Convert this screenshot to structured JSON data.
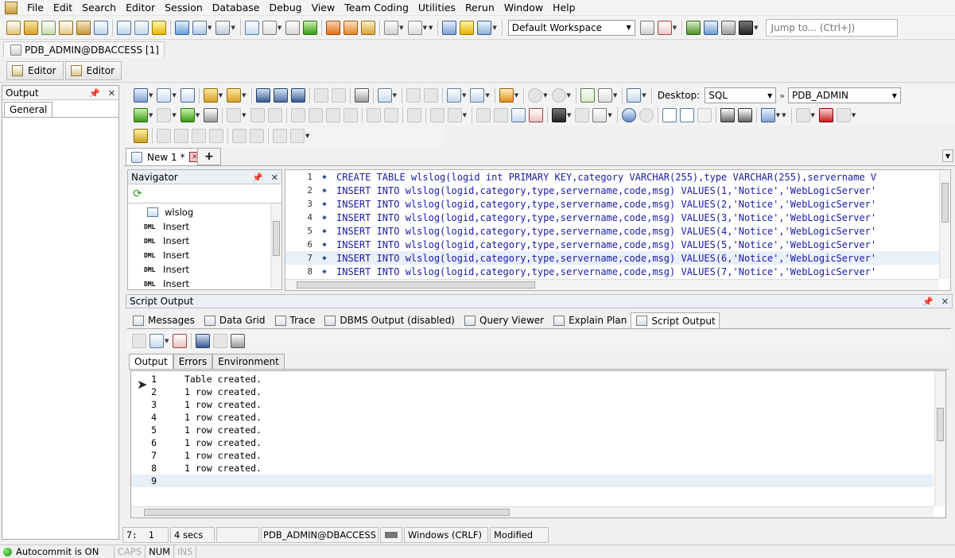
{
  "menu": [
    "File",
    "Edit",
    "Search",
    "Editor",
    "Session",
    "Database",
    "Debug",
    "View",
    "Team Coding",
    "Utilities",
    "Rerun",
    "Window",
    "Help"
  ],
  "toolbar": {
    "workspace": "Default Workspace",
    "jump_placeholder": "Jump to... (Ctrl+J)"
  },
  "connection_tab": "PDB_ADMIN@DBACCESS [1]",
  "editor_buttons": [
    "Editor",
    "Editor"
  ],
  "output_panel": {
    "title": "Output",
    "tab": "General"
  },
  "edit_toolbar": {
    "desktop_label": "Desktop:",
    "desktop_value": "SQL",
    "schema": "PDB_ADMIN"
  },
  "doc_tab": {
    "label": "New 1 *",
    "add": "+"
  },
  "navigator": {
    "title": "Navigator",
    "items": [
      {
        "badge": "",
        "label": "wlslog"
      },
      {
        "badge": "DML",
        "label": "Insert"
      },
      {
        "badge": "DML",
        "label": "Insert"
      },
      {
        "badge": "DML",
        "label": "Insert"
      },
      {
        "badge": "DML",
        "label": "Insert"
      },
      {
        "badge": "DML",
        "label": "Insert"
      }
    ]
  },
  "code_lines": [
    {
      "n": "1",
      "text": "CREATE TABLE wlslog(logid int PRIMARY KEY,category VARCHAR(255),type VARCHAR(255),servername V"
    },
    {
      "n": "2",
      "text": "INSERT INTO wlslog(logid,category,type,servername,code,msg) VALUES(1,'Notice','WebLogicServer'"
    },
    {
      "n": "3",
      "text": "INSERT INTO wlslog(logid,category,type,servername,code,msg) VALUES(2,'Notice','WebLogicServer'"
    },
    {
      "n": "4",
      "text": "INSERT INTO wlslog(logid,category,type,servername,code,msg) VALUES(3,'Notice','WebLogicServer'"
    },
    {
      "n": "5",
      "text": "INSERT INTO wlslog(logid,category,type,servername,code,msg) VALUES(4,'Notice','WebLogicServer'"
    },
    {
      "n": "6",
      "text": "INSERT INTO wlslog(logid,category,type,servername,code,msg) VALUES(5,'Notice','WebLogicServer'"
    },
    {
      "n": "7",
      "text": "INSERT INTO wlslog(logid,category,type,servername,code,msg) VALUES(6,'Notice','WebLogicServer'"
    },
    {
      "n": "8",
      "text": "INSERT INTO wlslog(logid,category,type,servername,code,msg) VALUES(7,'Notice','WebLogicServer'"
    }
  ],
  "script_output": {
    "title": "Script Output",
    "tabs": [
      "Messages",
      "Data Grid",
      "Trace",
      "DBMS Output (disabled)",
      "Query Viewer",
      "Explain Plan",
      "Script Output"
    ],
    "sub_tabs": [
      "Output",
      "Errors",
      "Environment"
    ],
    "lines": [
      {
        "n": "1",
        "text": "Table created."
      },
      {
        "n": "2",
        "text": "1 row created."
      },
      {
        "n": "3",
        "text": "1 row created."
      },
      {
        "n": "4",
        "text": "1 row created."
      },
      {
        "n": "5",
        "text": "1 row created."
      },
      {
        "n": "6",
        "text": "1 row created."
      },
      {
        "n": "7",
        "text": "1 row created."
      },
      {
        "n": "8",
        "text": "1 row created."
      },
      {
        "n": "9",
        "text": ""
      }
    ]
  },
  "status": {
    "position": "7:  1",
    "elapsed": "4 secs",
    "connection": "PDB_ADMIN@DBACCESS",
    "line_ending": "Windows (CRLF)",
    "state": "Modified"
  },
  "bottom": {
    "autocommit": "Autocommit is ON",
    "caps": "CAPS",
    "num": "NUM",
    "ins": "INS"
  }
}
